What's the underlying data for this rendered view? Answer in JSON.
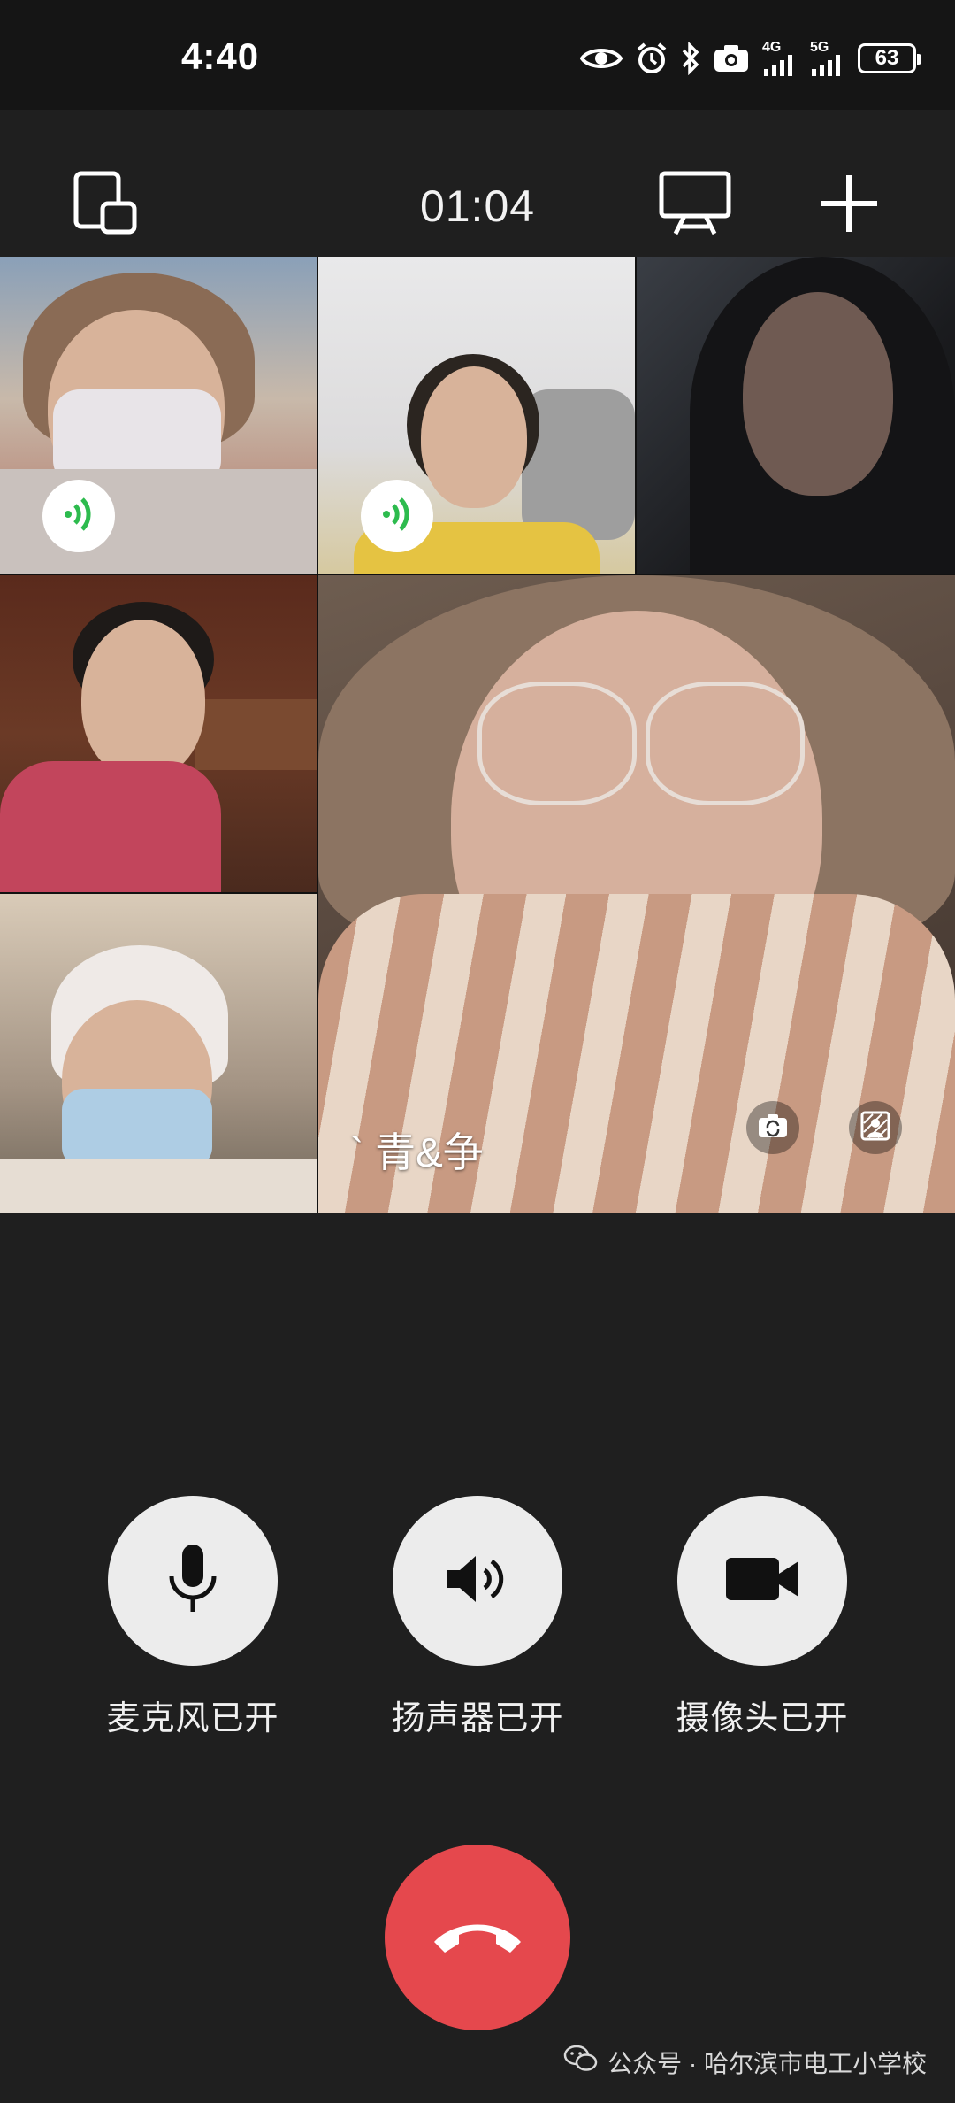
{
  "status_bar": {
    "time": "4:40",
    "network_4g": "4G",
    "network_5g": "5G",
    "battery": "63",
    "icons": [
      "eye-icon",
      "alarm-icon",
      "bluetooth-icon",
      "camera-icon",
      "signal-4g-icon",
      "signal-5g-icon",
      "battery-icon"
    ]
  },
  "toolbar": {
    "call_timer": "01:04",
    "icons": [
      "minimize-window-icon",
      "screen-share-icon",
      "add-participant-icon"
    ]
  },
  "participants": [
    {
      "id": "p1",
      "speaking": true
    },
    {
      "id": "p2",
      "speaking": true
    },
    {
      "id": "p3",
      "speaking": false
    },
    {
      "id": "p4",
      "speaking": false
    },
    {
      "id": "p5",
      "speaking": false
    },
    {
      "id": "self",
      "name": "` 青&争",
      "speaking": false,
      "controls": [
        "switch-camera-icon",
        "background-blur-icon"
      ]
    }
  ],
  "controls": {
    "microphone_label": "麦克风已开",
    "speaker_label": "扬声器已开",
    "camera_label": "摄像头已开"
  },
  "hangup": {
    "color": "#e5484d",
    "icon": "hang-up-icon"
  },
  "watermark": {
    "text": "公众号 · 哈尔滨市电工小学校"
  },
  "colors": {
    "background": "#1f1f1f",
    "control_circle": "#ececec",
    "speaking_indicator": "#2dbb4e"
  }
}
